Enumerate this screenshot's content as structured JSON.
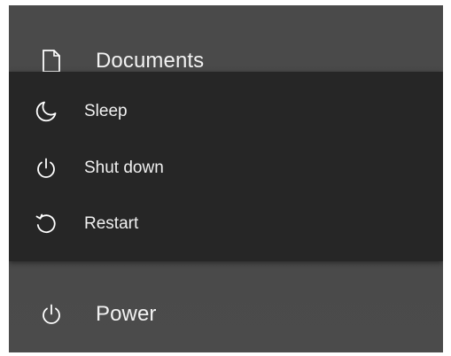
{
  "menu": {
    "documents": {
      "label": "Documents",
      "icon": "document-icon"
    },
    "power": {
      "label": "Power",
      "icon": "power-icon"
    }
  },
  "power_flyout": {
    "items": [
      {
        "label": "Sleep",
        "icon": "moon-icon"
      },
      {
        "label": "Shut down",
        "icon": "power-icon"
      },
      {
        "label": "Restart",
        "icon": "restart-icon"
      }
    ]
  },
  "colors": {
    "menu_background": "#4a4a4a",
    "flyout_background": "#262626",
    "text": "#f2f2f2"
  }
}
